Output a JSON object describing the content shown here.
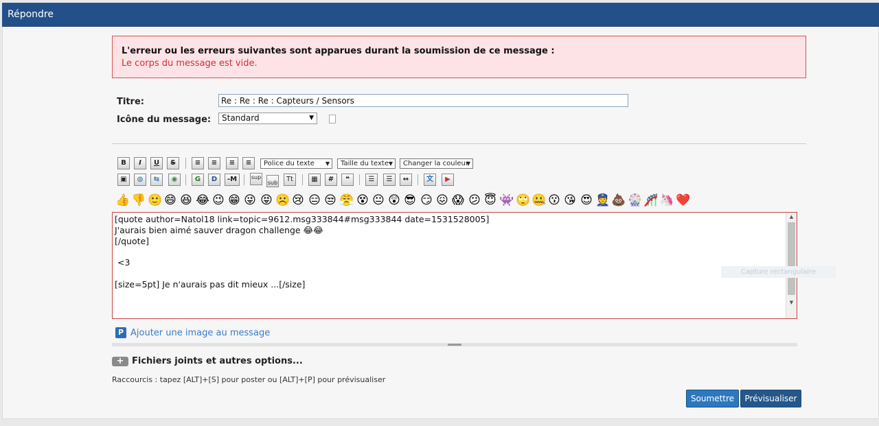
{
  "header": {
    "title": "Répondre"
  },
  "error": {
    "title": "L'erreur ou les erreurs suivantes sont apparues durant la soumission de ce message :",
    "message": "Le corps du message est vide."
  },
  "form": {
    "title_label": "Titre:",
    "title_value": "Re : Re : Re : Capteurs / Sensors",
    "icon_label": "Icône du message:",
    "icon_value": "Standard"
  },
  "toolbar": {
    "font_select": "Police du texte",
    "size_select": "Taille du texte",
    "color_select": "Changer la couleur",
    "row1": [
      "B",
      "I",
      "U",
      "S",
      "align-left",
      "align-center",
      "align-center",
      "align-right"
    ],
    "row2": [
      "flash",
      "globe",
      "ftp",
      "image",
      "G",
      "D",
      "-M",
      "sup",
      "sub",
      "Tt",
      "table",
      "#",
      "quote",
      "list",
      "ordered-list",
      "hr",
      "tt",
      "pdf"
    ],
    "sup_label": "sup",
    "sub_label": "sub"
  },
  "emojis": [
    "👍",
    "👎",
    "🙂",
    "😄",
    "😆",
    "😂",
    "😉",
    "😁",
    "😜",
    "😝",
    "☹️",
    "😢",
    "😑",
    "😒",
    "😤",
    "😵",
    "😐",
    "😲",
    "😎",
    "😏",
    "😖",
    "😱",
    "😕",
    "😇",
    "👾",
    "🙄",
    "🤐",
    "😗",
    "😘",
    "😍",
    "👮",
    "💩",
    "🎡",
    "🎢",
    "🦄",
    "❤️"
  ],
  "editor": {
    "content": "[quote author=Natol18 link=topic=9612.msg333844#msg333844 date=1531528005]\nJ'aurais bien aimé sauver dragon challenge 😂😂\n[/quote]\n\n <3\n\n[size=5pt] Je n'aurais pas dit mieux ...[/size]"
  },
  "overlay": {
    "text": "Capture rectangulaire"
  },
  "attachments": {
    "add_image": "Ajouter une image au message",
    "files_label": "Fichiers joints et autres options...",
    "plus": "+"
  },
  "shortcuts": "Raccourcis : tapez [ALT]+[S] pour poster ou [ALT]+[P] pour prévisualiser",
  "buttons": {
    "submit": "Soumettre",
    "preview": "Prévisualiser"
  },
  "colors": {
    "header": "#245089",
    "error_bg": "#fde3e6",
    "error_text": "#d0312d",
    "link": "#3a7cc4"
  }
}
